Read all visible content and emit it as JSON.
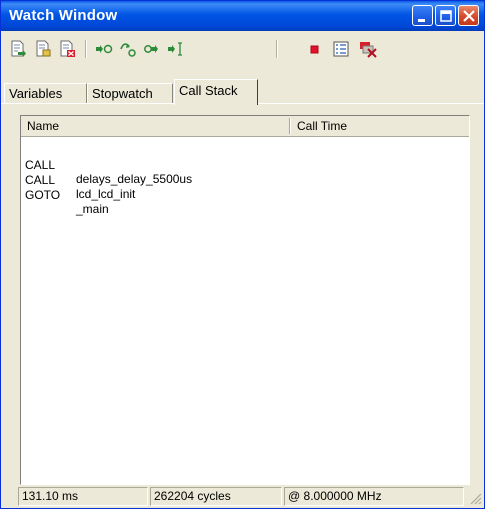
{
  "window": {
    "title": "Watch Window"
  },
  "title_buttons": [
    {
      "name": "minimize-button"
    },
    {
      "name": "maximize-button"
    },
    {
      "name": "close-button"
    }
  ],
  "toolbar": {
    "icons": [
      "add-watch-icon",
      "add-watch-file-icon",
      "delete-watch-icon",
      "step-into-icon",
      "step-over-icon",
      "step-out-icon",
      "run-to-cursor-icon",
      "stop-icon",
      "properties-icon",
      "clear-icon"
    ]
  },
  "tabs": [
    {
      "label": "Variables",
      "active": false
    },
    {
      "label": "Stopwatch",
      "active": false
    },
    {
      "label": "Call Stack",
      "active": true
    }
  ],
  "callstack": {
    "columns": [
      "Name",
      "Call Time"
    ],
    "rows": [
      {
        "kind": "CALL",
        "target": "delays_delay_5500us"
      },
      {
        "kind": "CALL",
        "target": "lcd_lcd_init"
      },
      {
        "kind": "GOTO",
        "target": "_main"
      }
    ]
  },
  "status": {
    "time": "131.10 ms",
    "cycles": "262204 cycles",
    "clock": "@ 8.000000 MHz"
  },
  "colors": {
    "titlebar": "#0055e5",
    "window_bg": "#ece9d8",
    "stop_red": "#e4102c",
    "step_green": "#2e8b3a"
  }
}
